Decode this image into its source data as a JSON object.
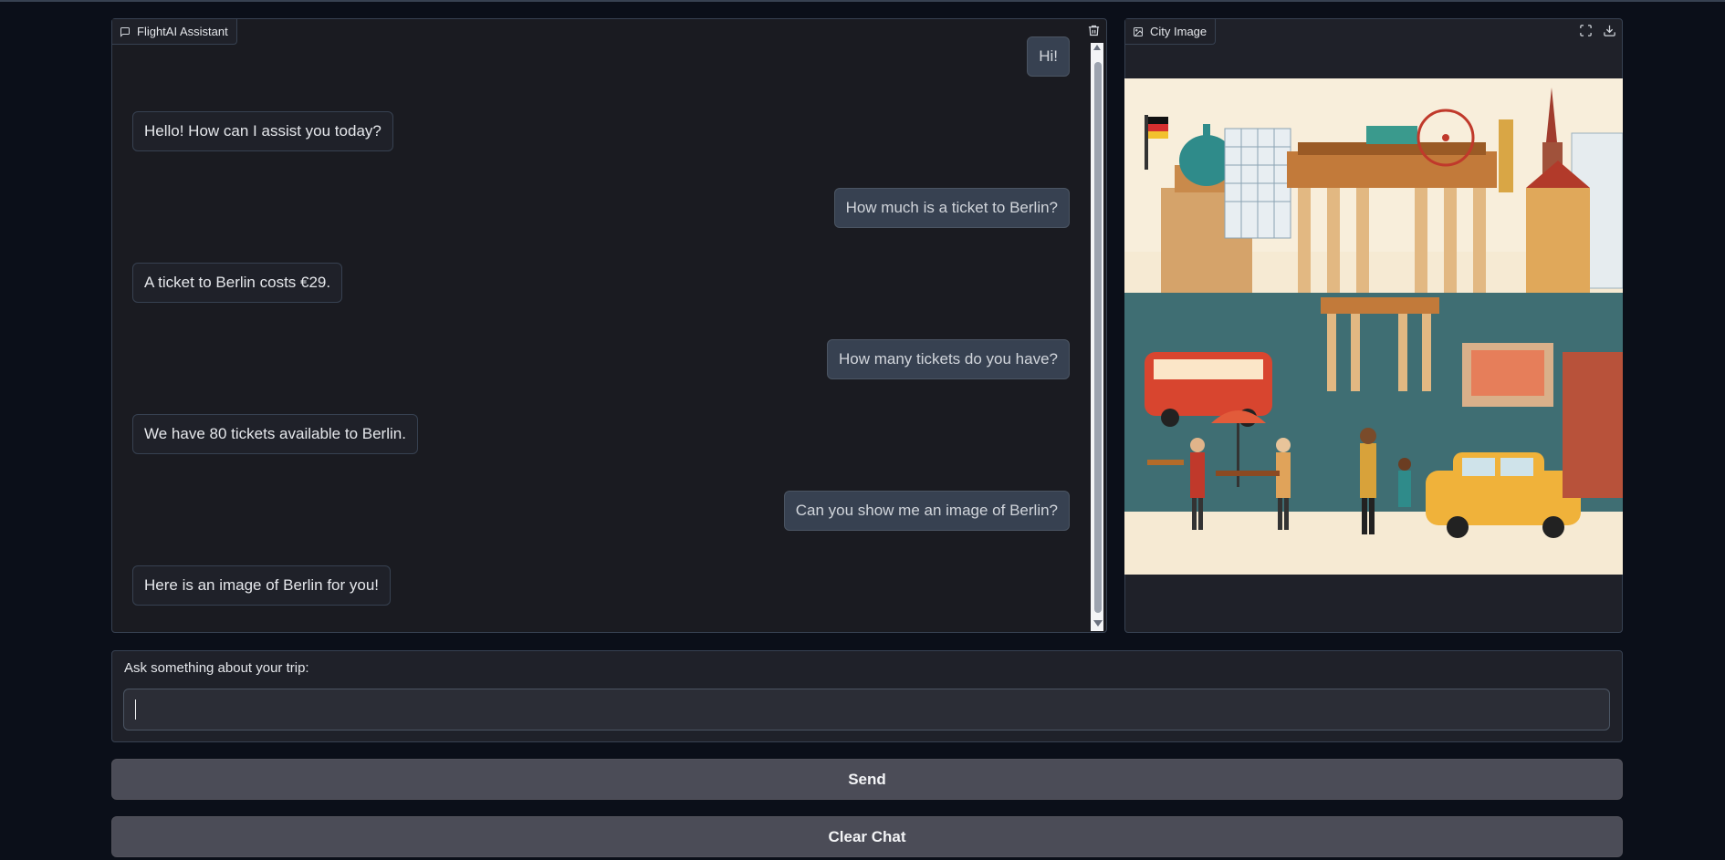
{
  "chat": {
    "label": "FlightAI Assistant",
    "messages": [
      {
        "role": "user",
        "text": "Hi!"
      },
      {
        "role": "bot",
        "text": "Hello! How can I assist you today?"
      },
      {
        "role": "user",
        "text": "How much is a ticket to Berlin?"
      },
      {
        "role": "bot",
        "text": "A ticket to Berlin costs €29."
      },
      {
        "role": "user",
        "text": "How many tickets do you have?"
      },
      {
        "role": "bot",
        "text": "We have 80 tickets available to Berlin."
      },
      {
        "role": "user",
        "text": "Can you show me an image of Berlin?"
      },
      {
        "role": "bot",
        "text": "Here is an image of Berlin for you!"
      }
    ]
  },
  "image_panel": {
    "label": "City Image",
    "image_icon": "image-icon",
    "expand_icon": "fullscreen-icon",
    "download_icon": "download-icon"
  },
  "input": {
    "label": "Ask something about your trip:",
    "value": "",
    "placeholder": ""
  },
  "buttons": {
    "send": "Send",
    "clear": "Clear Chat"
  },
  "colors": {
    "background": "#0b0f19",
    "panel": "#1f2129",
    "button": "#4b4c57",
    "user_bubble": "#374151"
  }
}
